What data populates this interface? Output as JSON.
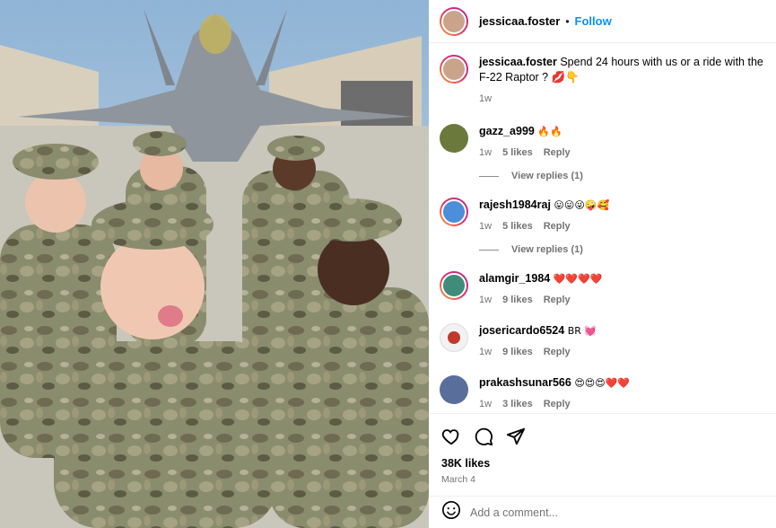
{
  "post": {
    "username": "jessicaa.foster",
    "follow_label": "Follow",
    "separator": "•",
    "caption_text": "Spend 24 hours with us or a ride with the F-22 Raptor ? 💋👇",
    "caption_time": "1w"
  },
  "comments": [
    {
      "username": "gazz_a999",
      "text": "🔥🔥",
      "time": "1w",
      "likes": "5 likes",
      "reply_label": "Reply",
      "view_replies": "View replies (1)"
    },
    {
      "username": "rajesh1984raj",
      "text": "😛😛😜🤪🥰",
      "time": "1w",
      "likes": "5 likes",
      "reply_label": "Reply",
      "view_replies": "View replies (1)"
    },
    {
      "username": "alamgir_1984",
      "text": "❤️❤️❤️❤️",
      "time": "1w",
      "likes": "9 likes",
      "reply_label": "Reply"
    },
    {
      "username": "josericardo6524",
      "text": "BR 💓",
      "time": "1w",
      "likes": "9 likes",
      "reply_label": "Reply"
    },
    {
      "username": "prakashsunar566",
      "text": "😍😍😍❤️❤️",
      "time": "1w",
      "likes": "3 likes",
      "reply_label": "Reply"
    }
  ],
  "footer": {
    "likes_count": "38K likes",
    "post_date": "March 4",
    "add_comment_placeholder": "Add a comment..."
  },
  "icons": [
    "heart-icon",
    "comment-icon",
    "share-icon",
    "emoji-icon"
  ],
  "colors": {
    "follow": "#0095f6",
    "meta_gray": "#737373",
    "story_ring": "#e1306c"
  }
}
